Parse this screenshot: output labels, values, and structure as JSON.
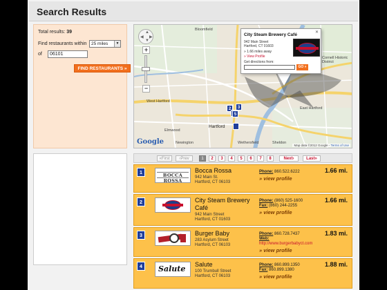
{
  "header": {
    "title": "Search Results"
  },
  "search": {
    "total_label": "Total results:",
    "total_value": "39",
    "within_label": "Find restaurants within",
    "radius_value": "25 miles",
    "of_label": "of",
    "zip_value": "06101",
    "find_button": "FIND RESTAURANTS »"
  },
  "map": {
    "labels": {
      "west_hartford": "West Hartford",
      "hartford": "Hartford",
      "elmwood": "Elmwood",
      "bloomfield": "Bloomfield",
      "wethersfield": "Wethersfield",
      "east_hartford": "East Hartford",
      "newington": "Newington",
      "cornell": "Cornell Historic\nDistrict",
      "sheldon": "Sheldon"
    },
    "copyright": "Map data ©2012 Google - ",
    "terms": "Terms of Use",
    "google": "Google",
    "markers": [
      "1",
      "2",
      "3",
      "4",
      "5"
    ],
    "info": {
      "title": "City Steam Brewery Café",
      "close": "✕",
      "address1": "942 Main Street",
      "address2": "Hartford, CT 01603",
      "distance": "» 1.66 miles away",
      "view_profile": "» View Profile",
      "directions_label": "Get directions from:",
      "go": "GO »"
    }
  },
  "pager": {
    "first": "«First",
    "prev": "‹Prev",
    "pages": [
      "1",
      "2",
      "3",
      "4",
      "5",
      "6",
      "7",
      "8"
    ],
    "current": "1",
    "next": "Next›",
    "last": "Last»"
  },
  "results": [
    {
      "num": "1",
      "logo": "BOCCA ROSSA",
      "name": "Bocca Rossa",
      "addr1": "942 Main St.",
      "addr2": "Hartford, CT 06103",
      "phone_label": "Phone:",
      "phone": "860.522.6222",
      "view": "» view profile",
      "dist": "1.66 mi."
    },
    {
      "num": "2",
      "name": "City Steam Brewery Café",
      "addr1": "942 Main Street",
      "addr2": "Hartford, CT 01603",
      "phone_label": "Phone:",
      "phone": "(860) 525-1600",
      "fax_label": "Fax:",
      "fax": "(860) 244-2255",
      "view": "» view profile",
      "dist": "1.66 mi."
    },
    {
      "num": "3",
      "name": "Burger Baby",
      "addr1": "283 Asylum Street",
      "addr2": "Hartford, CT 06103",
      "phone_label": "Phone:",
      "phone": "860.728.7437",
      "web_label": "Web:",
      "web": "http://www.burgerbabyct.com",
      "view": "» view profile",
      "dist": "1.83 mi."
    },
    {
      "num": "4",
      "logo": "Salute",
      "name": "Salute",
      "addr1": "100 Trumbull Street",
      "addr2": "Hartford, CT 06103",
      "phone_label": "Phone:",
      "phone": "860.899.1350",
      "fax_label": "Fax:",
      "fax": "860.899.1380",
      "view": "» view profile",
      "dist": "1.88 mi."
    }
  ],
  "colors": {
    "accent": "#f26f1d",
    "result_bg": "#fdc14a",
    "marker": "#1f3e9b",
    "link": "#c8102e"
  }
}
